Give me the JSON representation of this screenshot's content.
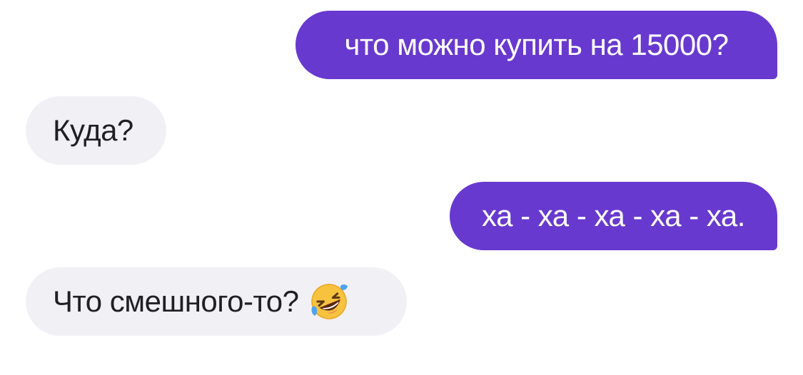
{
  "conversation": {
    "messages": [
      {
        "sender": "user",
        "text": "что можно купить на 15000?"
      },
      {
        "sender": "assistant",
        "text": "Куда?"
      },
      {
        "sender": "user",
        "text": "ха - ха - ха - ха - ха."
      },
      {
        "sender": "assistant",
        "text": "Что смешного-то?",
        "emoji": "rolling-on-floor-laughing-icon"
      }
    ]
  },
  "colors": {
    "user_bubble": "#6839cf",
    "assistant_bubble": "#f1f0f4",
    "user_text": "#ffffff",
    "assistant_text": "#1f1f24"
  }
}
